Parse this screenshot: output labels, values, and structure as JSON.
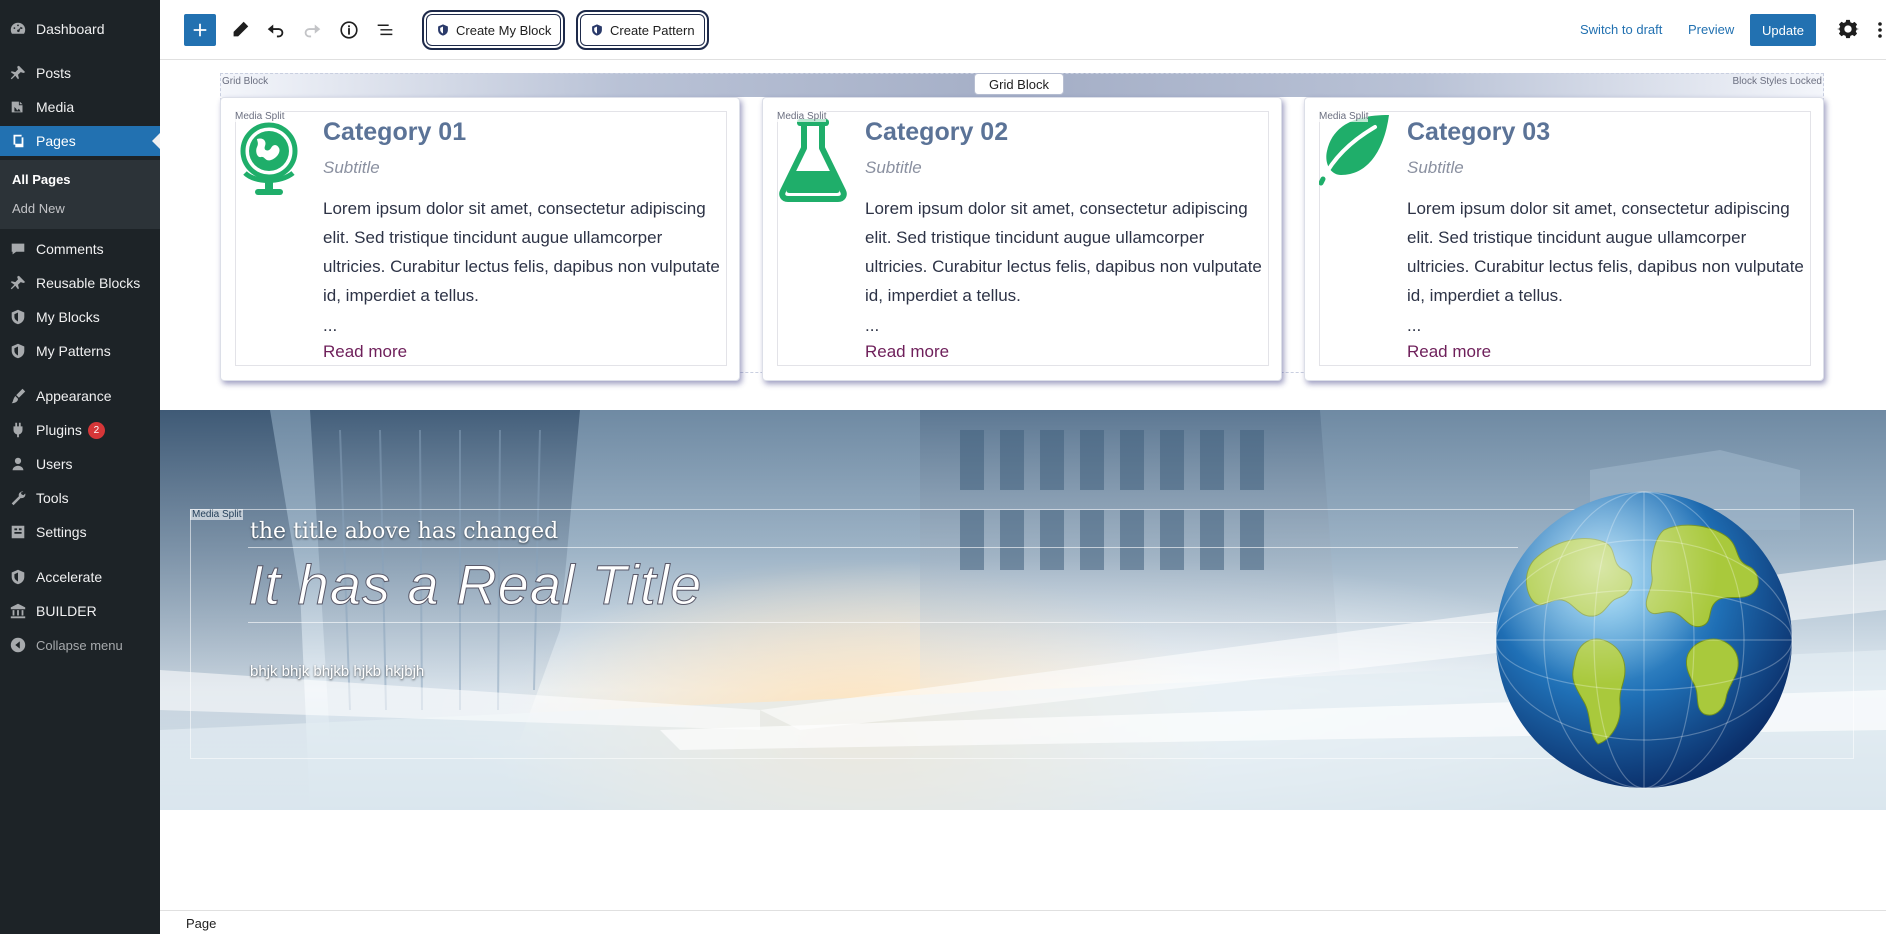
{
  "sidebar": {
    "items": [
      {
        "label": "Dashboard",
        "icon": "dashboard-icon"
      },
      {
        "label": "Posts",
        "icon": "pin-icon"
      },
      {
        "label": "Media",
        "icon": "media-icon"
      },
      {
        "label": "Pages",
        "icon": "pages-icon",
        "current": true
      },
      {
        "label": "Comments",
        "icon": "comments-icon"
      },
      {
        "label": "Reusable Blocks",
        "icon": "pin-icon"
      },
      {
        "label": "My Blocks",
        "icon": "shield-icon"
      },
      {
        "label": "My Patterns",
        "icon": "shield-icon"
      },
      {
        "label": "Appearance",
        "icon": "brush-icon"
      },
      {
        "label": "Plugins",
        "icon": "plug-icon",
        "badge": "2"
      },
      {
        "label": "Users",
        "icon": "users-icon"
      },
      {
        "label": "Tools",
        "icon": "wrench-icon"
      },
      {
        "label": "Settings",
        "icon": "settings-icon"
      },
      {
        "label": "Accelerate",
        "icon": "shield-icon"
      },
      {
        "label": "BUILDER",
        "icon": "bank-icon"
      }
    ],
    "submenu": [
      {
        "label": "All Pages",
        "current": true
      },
      {
        "label": "Add New"
      }
    ],
    "collapse_label": "Collapse menu",
    "background": "#1d2327",
    "accent": "#2271b1"
  },
  "toolbar": {
    "create_block_label": "Create My Block",
    "create_pattern_label": "Create Pattern",
    "switch_draft_label": "Switch to draft",
    "preview_label": "Preview",
    "update_label": "Update"
  },
  "grid": {
    "label": "Grid Block",
    "title_tag": "Grid Block",
    "locked_label": "Block Styles Locked",
    "media_split_label": "Media Split",
    "cards": [
      {
        "icon": "globe-icon",
        "title": "Category 01",
        "subtitle": "Subtitle",
        "body": "Lorem ipsum dolor sit amet, consectetur adipiscing elit. Sed tristique tincidunt augue ullamcorper ultricies. Curabitur lectus felis, dapibus non vulputate id, imperdiet a tellus.",
        "ellipsis": "...",
        "link": "Read more"
      },
      {
        "icon": "flask-icon",
        "title": "Category 02",
        "subtitle": "Subtitle",
        "body": "Lorem ipsum dolor sit amet, consectetur adipiscing elit. Sed tristique tincidunt augue ullamcorper ultricies. Curabitur lectus felis, dapibus non vulputate id, imperdiet a tellus.",
        "ellipsis": "...",
        "link": "Read more"
      },
      {
        "icon": "leaf-icon",
        "title": "Category 03",
        "subtitle": "Subtitle",
        "body": "Lorem ipsum dolor sit amet, consectetur adipiscing elit. Sed tristique tincidunt augue ullamcorper ultricies. Curabitur lectus felis, dapibus non vulputate id, imperdiet a tellus.",
        "ellipsis": "...",
        "link": "Read more"
      }
    ],
    "icon_color": "#1fae6a"
  },
  "hero": {
    "media_split_label": "Media Split",
    "kicker": "the title above has changed",
    "title": "It has a Real Title",
    "body": "bhjk bhjk bhjkb hjkb hkjbjh",
    "image": "earth-globe-icon"
  },
  "footer": {
    "breadcrumb": "Page"
  }
}
